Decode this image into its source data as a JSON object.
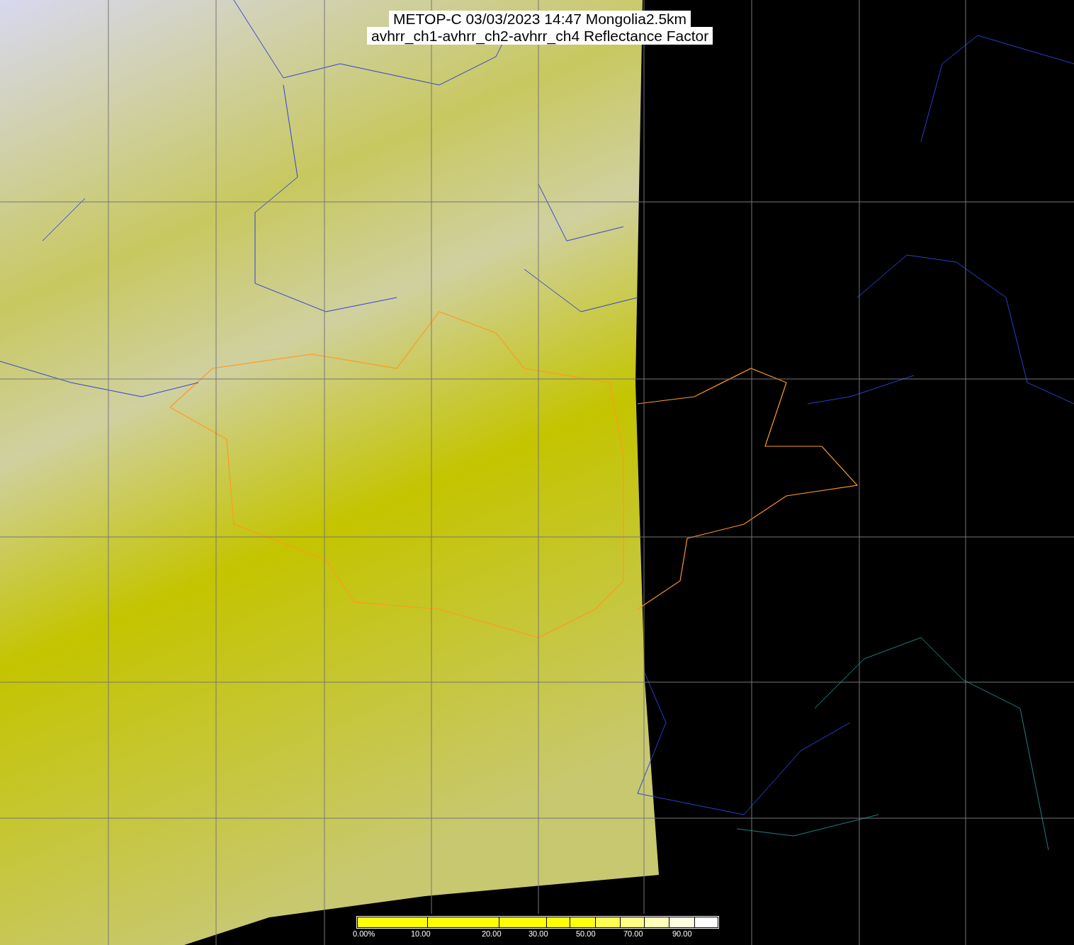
{
  "title": {
    "line_1": "METOP-C 03/03/2023 14:47 Mongolia2.5km",
    "line_2": "avhrr_ch1-avhrr_ch2-avhrr_ch4 Reflectance Factor"
  },
  "colorbar": {
    "segments": [
      {
        "color": "#ffff00"
      },
      {
        "color": "#ffff00"
      },
      {
        "color": "#ffff00"
      },
      {
        "color": "#ffff00"
      },
      {
        "color": "#ffff10"
      },
      {
        "color": "#ffff50"
      },
      {
        "color": "#ffff88"
      },
      {
        "color": "#ffffb8"
      },
      {
        "color": "#ffffe0"
      },
      {
        "color": "#ffffff"
      }
    ],
    "tick_labels": [
      "0.00%",
      "10.00",
      "20.00",
      "30.00",
      "50.00",
      "70.00",
      "90.00"
    ]
  }
}
